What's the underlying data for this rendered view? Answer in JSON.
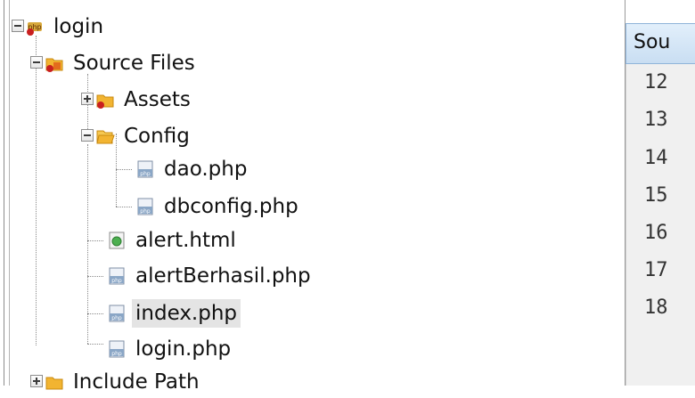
{
  "tree": {
    "root": {
      "label": "login",
      "icon": "php-project-icon"
    },
    "source_files": {
      "label": "Source Files",
      "icon": "source-folder-icon"
    },
    "assets": {
      "label": "Assets",
      "icon": "folder-icon"
    },
    "config": {
      "label": "Config",
      "icon": "folder-open-icon"
    },
    "config_children": [
      {
        "label": "dao.php",
        "icon": "php-file-icon"
      },
      {
        "label": "dbconfig.php",
        "icon": "php-file-icon"
      }
    ],
    "files": [
      {
        "label": "alert.html",
        "icon": "html-file-icon"
      },
      {
        "label": "alertBerhasil.php",
        "icon": "php-file-icon"
      },
      {
        "label": "index.php",
        "icon": "php-file-icon",
        "selected": true
      },
      {
        "label": "login.php",
        "icon": "php-file-icon"
      }
    ],
    "include_path": {
      "label": "Include Path",
      "icon": "folder-icon"
    }
  },
  "editor": {
    "tab_label": "Sou",
    "line_numbers": [
      "12",
      "13",
      "14",
      "15",
      "16",
      "17",
      "18"
    ]
  },
  "colors": {
    "tab_background": "#c9def2",
    "selection": "#e4e4e4",
    "folder": "#f2b431"
  }
}
